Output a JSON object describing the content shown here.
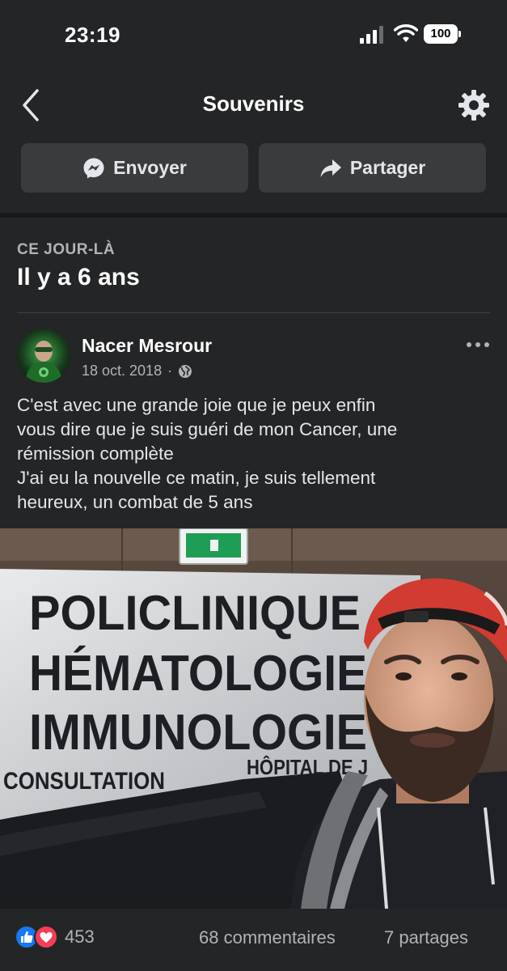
{
  "status_bar": {
    "time": "23:19",
    "battery": "100",
    "icons": [
      "signal-icon",
      "wifi-icon",
      "battery-icon"
    ]
  },
  "header": {
    "title": "Souvenirs",
    "back_icon": "chevron-left-icon",
    "settings_icon": "gear-icon"
  },
  "actions": {
    "send_label": "Envoyer",
    "send_icon": "messenger-icon",
    "share_label": "Partager",
    "share_icon": "share-arrow-icon"
  },
  "memory": {
    "kicker": "CE JOUR-LÀ",
    "title": "Il y a 6 ans"
  },
  "post": {
    "author": "Nacer Mesrour",
    "date": "18 oct. 2018",
    "separator": "·",
    "privacy_icon": "globe-icon",
    "text_lines": [
      "C'est avec une grande joie que je peux enfin",
      "vous dire que je suis guéri de mon Cancer, une",
      "rémission complète",
      "J'ai eu la nouvelle ce matin, je suis tellement",
      "heureux, un combat de 5 ans"
    ],
    "photo": {
      "sign_lines": [
        "POLICLINIQUE",
        "HÉMATOLOGIE",
        "IMMUNOLOGIE"
      ],
      "sign_consultation": "CONSULTATION",
      "sign_hospital": "HÔPITAL DE J"
    }
  },
  "footer": {
    "reaction_icons": [
      "like-icon",
      "love-icon"
    ],
    "reaction_count": "453",
    "comments": "68 commentaires",
    "shares": "7 partages"
  },
  "colors": {
    "background": "#242526",
    "button": "#3a3b3c",
    "like_blue": "#1877f2",
    "love_red": "#f33e58"
  }
}
